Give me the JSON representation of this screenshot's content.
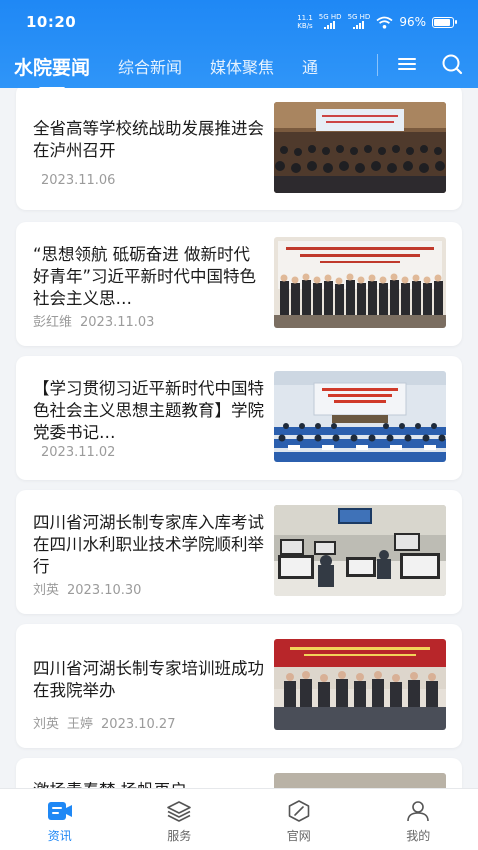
{
  "status": {
    "time": "10:20",
    "speed_top": "11.1",
    "speed_unit": "KB/s",
    "net1_top": "5G HD",
    "net2_top": "5G HD",
    "battery": "96%",
    "battery_level": 0.96
  },
  "nav": {
    "tabs": [
      {
        "label": "水院要闻",
        "active": true
      },
      {
        "label": "综合新闻"
      },
      {
        "label": "媒体聚焦"
      },
      {
        "label": "通"
      }
    ],
    "menu_icon": "menu-icon",
    "search_icon": "search-icon"
  },
  "articles": [
    {
      "title": "全省高等学校统战助发展推进会在泸州召开",
      "authors": [],
      "date": "2023.11.06",
      "thumb": "conference-hall-photo"
    },
    {
      "title": "“思想领航 砥砺奋进 做新时代好青年”习近平新时代中国特色社会主义思…",
      "authors": [
        "彭红维"
      ],
      "date": "2023.11.03",
      "thumb": "group-photo"
    },
    {
      "title": "【学习贯彻习近平新时代中国特色社会主义思想主题教育】学院党委书记…",
      "authors": [],
      "date": "2023.11.02",
      "thumb": "lecture-hall-photo"
    },
    {
      "title": "四川省河湖长制专家库入库考试在四川水利职业技术学院顺利举行",
      "authors": [
        "刘英"
      ],
      "date": "2023.10.30",
      "thumb": "computer-lab-photo"
    },
    {
      "title": "四川省河湖长制专家培训班成功在我院举办",
      "authors": [
        "刘英",
        "王婷"
      ],
      "date": "2023.10.27",
      "thumb": "training-class-photo"
    },
    {
      "title": "激扬青春梦 扬帆再启",
      "authors": [],
      "date": "",
      "thumb": "event-photo"
    }
  ],
  "tabbar": [
    {
      "label": "资讯",
      "icon": "news-icon",
      "active": true
    },
    {
      "label": "服务",
      "icon": "layers-icon"
    },
    {
      "label": "官网",
      "icon": "compass-icon"
    },
    {
      "label": "我的",
      "icon": "user-icon"
    }
  ],
  "colors": {
    "primary": "#1f88f5",
    "background": "#f2f4f7",
    "card": "#ffffff",
    "meta": "#9b9b9b"
  }
}
